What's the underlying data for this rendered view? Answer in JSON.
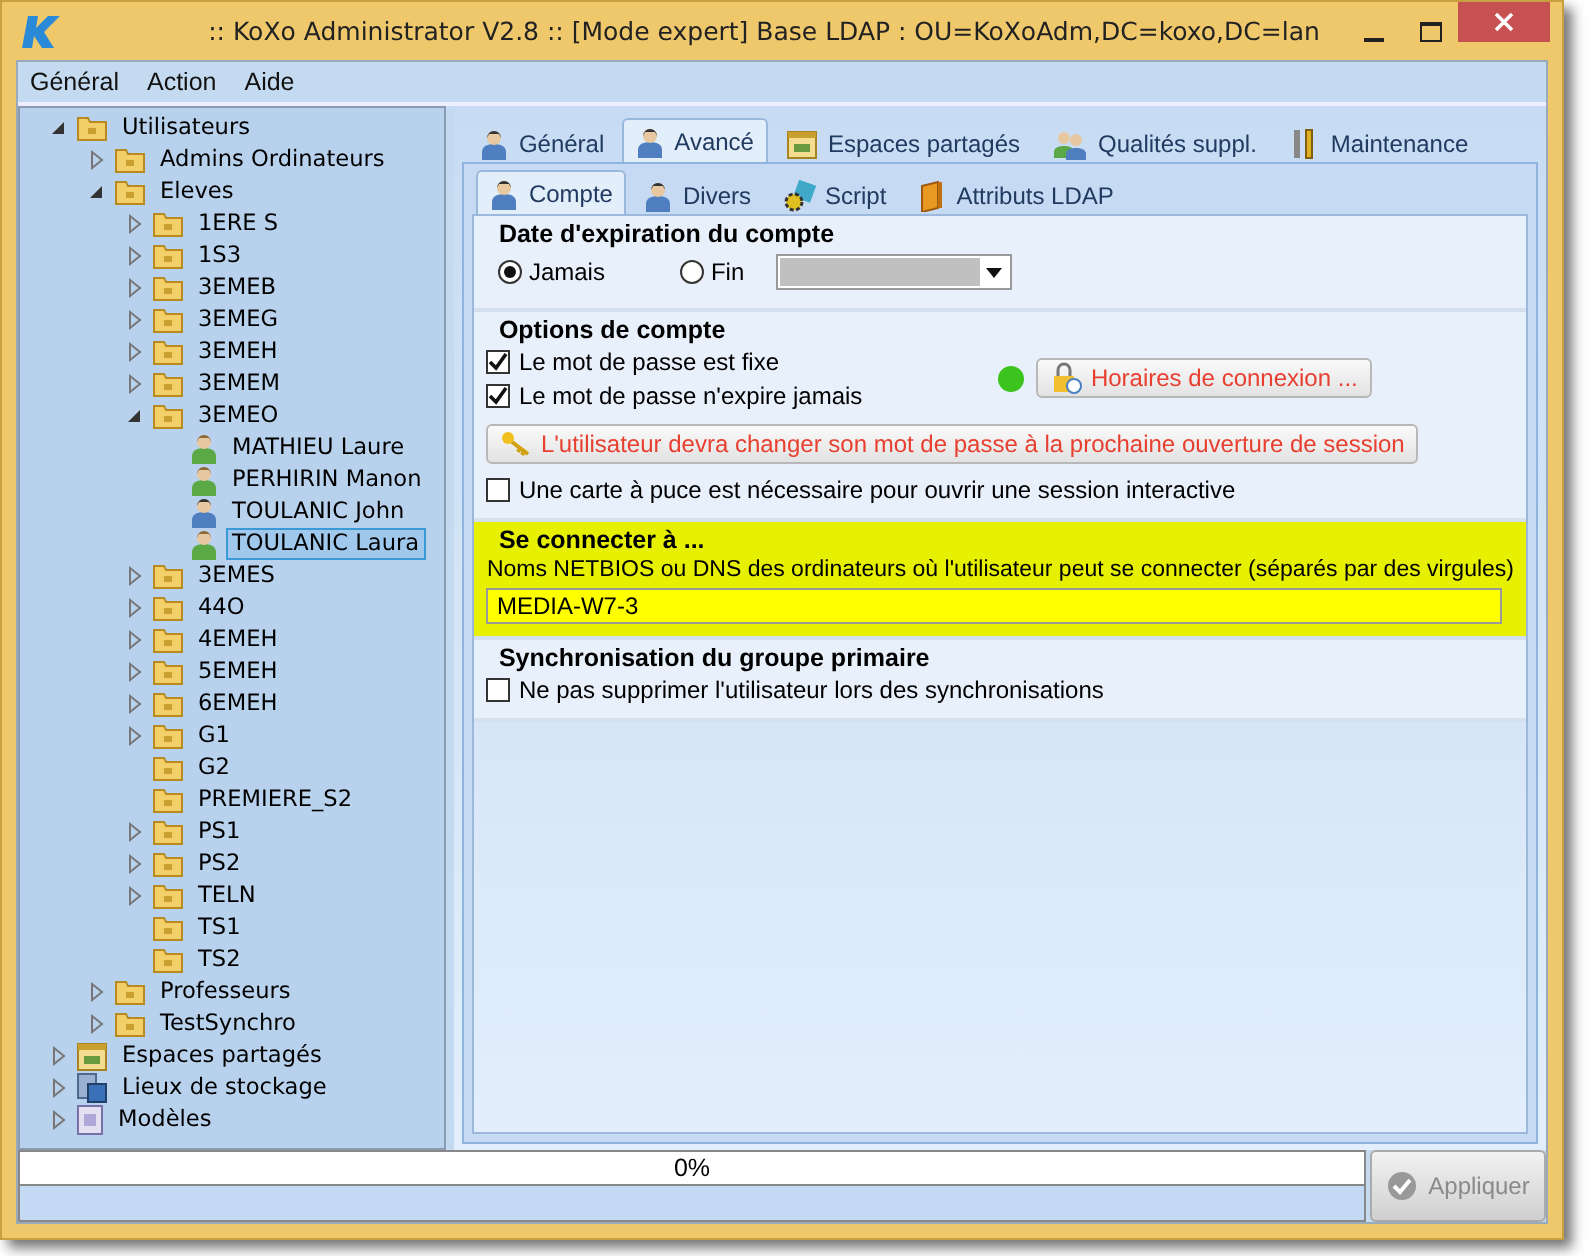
{
  "window": {
    "title": ":: KoXo Administrator V2.8 :: [Mode expert] Base LDAP : OU=KoXoAdm,DC=koxo,DC=lan"
  },
  "menu": [
    "Général",
    "Action",
    "Aide"
  ],
  "tree": [
    {
      "kind": "folder",
      "label": "Utilisateurs",
      "expanded": true,
      "selected": false,
      "children": [
        {
          "kind": "folder",
          "label": "Admins Ordinateurs",
          "expanded": false,
          "selected": false
        },
        {
          "kind": "folder",
          "label": "Eleves",
          "expanded": true,
          "selected": false,
          "children": [
            {
              "kind": "folder",
              "label": "1ERE S",
              "expanded": false,
              "selected": false
            },
            {
              "kind": "folder",
              "label": "1S3",
              "expanded": false,
              "selected": false
            },
            {
              "kind": "folder",
              "label": "3EMEB",
              "expanded": false,
              "selected": false
            },
            {
              "kind": "folder",
              "label": "3EMEG",
              "expanded": false,
              "selected": false
            },
            {
              "kind": "folder",
              "label": "3EMEH",
              "expanded": false,
              "selected": false
            },
            {
              "kind": "folder",
              "label": "3EMEM",
              "expanded": false,
              "selected": false
            },
            {
              "kind": "folder",
              "label": "3EMEO",
              "expanded": true,
              "selected": false,
              "children": [
                {
                  "kind": "woman",
                  "label": "MATHIEU Laure",
                  "selected": false
                },
                {
                  "kind": "woman",
                  "label": "PERHIRIN Manon",
                  "selected": false
                },
                {
                  "kind": "man",
                  "label": "TOULANIC John",
                  "selected": false
                },
                {
                  "kind": "woman",
                  "label": "TOULANIC Laura",
                  "selected": true
                }
              ]
            },
            {
              "kind": "folder",
              "label": "3EMES",
              "expanded": false,
              "selected": false
            },
            {
              "kind": "folder",
              "label": "44O",
              "expanded": false,
              "selected": false
            },
            {
              "kind": "folder",
              "label": "4EMEH",
              "expanded": false,
              "selected": false
            },
            {
              "kind": "folder",
              "label": "5EMEH",
              "expanded": false,
              "selected": false
            },
            {
              "kind": "folder",
              "label": "6EMEH",
              "expanded": false,
              "selected": false
            },
            {
              "kind": "folder",
              "label": "G1",
              "expanded": false,
              "selected": false
            },
            {
              "kind": "folder",
              "label": "G2",
              "selected": false
            },
            {
              "kind": "folder",
              "label": "PREMIERE_S2",
              "selected": false
            },
            {
              "kind": "folder",
              "label": "PS1",
              "expanded": false,
              "selected": false
            },
            {
              "kind": "folder",
              "label": "PS2",
              "expanded": false,
              "selected": false
            },
            {
              "kind": "folder",
              "label": "TELN",
              "expanded": false,
              "selected": false
            },
            {
              "kind": "folder",
              "label": "TS1",
              "selected": false
            },
            {
              "kind": "folder",
              "label": "TS2",
              "selected": false
            }
          ]
        },
        {
          "kind": "folder",
          "label": "Professeurs",
          "expanded": false,
          "selected": false
        },
        {
          "kind": "folder",
          "label": "TestSynchro",
          "expanded": false,
          "selected": false
        }
      ]
    },
    {
      "kind": "shares",
      "label": "Espaces partagés",
      "expanded": false,
      "selected": false
    },
    {
      "kind": "storage",
      "label": "Lieux de stockage",
      "expanded": false,
      "selected": false
    },
    {
      "kind": "models",
      "label": "Modèles",
      "expanded": false,
      "selected": false
    }
  ],
  "tabs": [
    {
      "kind": "user",
      "label": "Général",
      "selected": false
    },
    {
      "kind": "user",
      "label": "Avancé",
      "selected": true
    },
    {
      "kind": "calendar",
      "label": "Espaces partagés",
      "selected": false
    },
    {
      "kind": "users",
      "label": "Qualités suppl.",
      "selected": false
    },
    {
      "kind": "tools",
      "label": "Maintenance",
      "selected": false
    }
  ],
  "subtabs": [
    {
      "kind": "user",
      "label": "Compte",
      "selected": true
    },
    {
      "kind": "user",
      "label": "Divers",
      "selected": false
    },
    {
      "kind": "script",
      "label": "Script",
      "selected": false
    },
    {
      "kind": "book",
      "label": "Attributs LDAP",
      "selected": false
    }
  ],
  "expiration": {
    "title": "Date d'expiration du compte",
    "options": [
      {
        "label": "Jamais",
        "selected": true
      },
      {
        "label": "Fin",
        "selected": false
      }
    ],
    "date_field": {
      "disabled": true
    }
  },
  "account_options": {
    "title": "Options de compte",
    "checks": [
      {
        "label": "Le mot de passe est fixe",
        "checked": true
      },
      {
        "label": "Le mot de passe n'expire jamais",
        "checked": true
      }
    ],
    "status_light": {
      "color": "#3cc41e"
    },
    "hours_button": "Horaires de connexion ...",
    "change_password_button": "L'utilisateur devra changer son mot de passe à la prochaine ouverture de session",
    "smartcard": {
      "label": "Une carte à puce est nécessaire pour ouvrir une session interactive",
      "checked": false
    }
  },
  "connect": {
    "title": "Se connecter à ...",
    "highlighted": true,
    "hint": "Noms NETBIOS ou DNS des ordinateurs où l'utilisateur peut se connecter (séparés par des virgules)",
    "value": "MEDIA-W7-3"
  },
  "sync": {
    "title": "Synchronisation du groupe primaire",
    "check": {
      "label": "Ne pas supprimer l'utilisateur lors des synchronisations",
      "checked": false
    }
  },
  "progress": {
    "text": "0%",
    "level": 0
  },
  "apply_button": {
    "label": "Appliquer",
    "disabled": true
  }
}
